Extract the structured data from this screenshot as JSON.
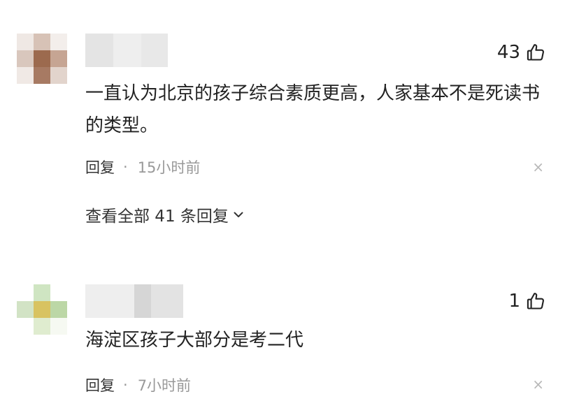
{
  "comments": [
    {
      "likes": "43",
      "text": "一直认为北京的孩子综合素质更高，人家基本不是死读书的类型。",
      "reply_label": "回复",
      "separator": "·",
      "time": "15小时前",
      "close": "×",
      "view_all": "查看全部 41 条回复"
    },
    {
      "likes": "1",
      "text": "海淀区孩子大部分是考二代",
      "reply_label": "回复",
      "separator": "·",
      "time": "7小时前",
      "close": "×"
    }
  ]
}
